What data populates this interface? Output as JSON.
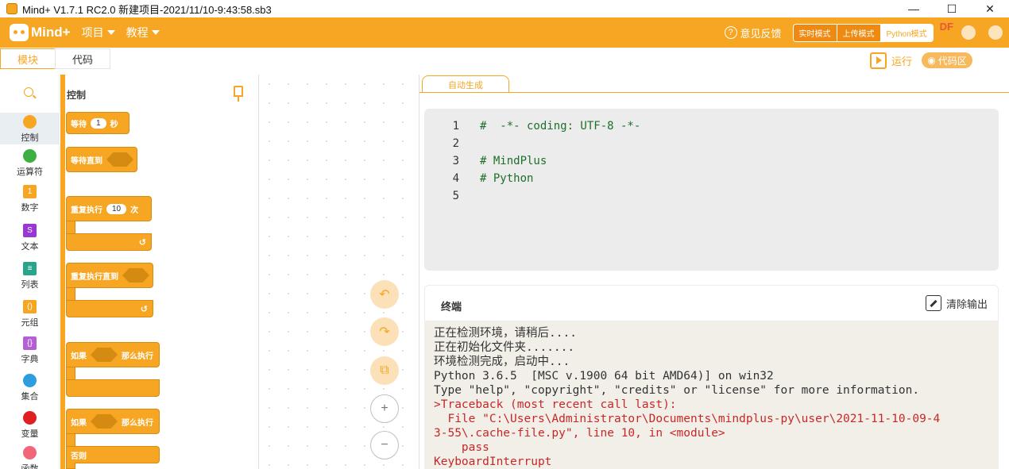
{
  "window": {
    "title": "Mind+ V1.7.1 RC2.0   新建项目-2021/11/10-9:43:58.sb3",
    "controls": [
      "—",
      "☐",
      "✕"
    ]
  },
  "header": {
    "logo": "Mind+",
    "menu": [
      {
        "label": "项目"
      },
      {
        "label": "教程"
      }
    ],
    "feedback": "意见反馈",
    "modes": [
      "实时模式",
      "上传模式",
      "Python模式"
    ],
    "active_mode": "Python模式",
    "watermark": "DF",
    "accent_color": "#f6a623"
  },
  "tabs": {
    "blocks": "模块",
    "code": "代码",
    "run": "运行",
    "code_zone": "代码区"
  },
  "categories": [
    {
      "label": "控制",
      "color": "#f6a623",
      "shape": "dot"
    },
    {
      "label": "运算符",
      "color": "#3cb043",
      "shape": "dot"
    },
    {
      "label": "数字",
      "color": "#f6a623",
      "shape": "square",
      "glyph": "1"
    },
    {
      "label": "文本",
      "color": "#9a36d6",
      "shape": "square",
      "glyph": "S"
    },
    {
      "label": "列表",
      "color": "#2aa58c",
      "shape": "square",
      "glyph": "≡"
    },
    {
      "label": "元组",
      "color": "#f6a623",
      "shape": "square",
      "glyph": "()"
    },
    {
      "label": "字典",
      "color": "#b45fd6",
      "shape": "square",
      "glyph": "{}"
    },
    {
      "label": "集合",
      "color": "#2c9ee0",
      "shape": "dot"
    },
    {
      "label": "变量",
      "color": "#e02020",
      "shape": "dot"
    },
    {
      "label": "函数",
      "color": "#f2667a",
      "shape": "dot"
    }
  ],
  "palette": {
    "section": "控制",
    "blocks": {
      "wait_label": "等待",
      "wait_value": "1",
      "wait_unit": "秒",
      "wait_until": "等待直到",
      "repeat_label": "重复执行",
      "repeat_value": "10",
      "repeat_unit": "次",
      "repeat_until": "重复执行直到",
      "if_label": "如果",
      "then_label": "那么执行",
      "if2_label": "如果",
      "then2_label": "那么执行",
      "else_label": "否则",
      "loop_arrow": "↺"
    }
  },
  "workspace": {
    "undo": "↶",
    "redo": "↷",
    "crop": "⧉",
    "zoom_in": "+",
    "zoom_out": "−"
  },
  "code_panel": {
    "tab": "自动生成",
    "lines": [
      {
        "n": "1",
        "text": "#  -*- coding: UTF-8 -*-"
      },
      {
        "n": "2",
        "text": ""
      },
      {
        "n": "3",
        "text": "# MindPlus"
      },
      {
        "n": "4",
        "text": "# Python"
      },
      {
        "n": "5",
        "text": ""
      }
    ]
  },
  "terminal": {
    "title": "终端",
    "clear": "清除输出",
    "lines": [
      {
        "text": "正在检测环境，请稍后....",
        "kind": "normal"
      },
      {
        "text": "正在初始化文件夹.......",
        "kind": "normal"
      },
      {
        "text": "环境检测完成，启动中...",
        "kind": "normal"
      },
      {
        "text": "Python 3.6.5  [MSC v.1900 64 bit AMD64)] on win32",
        "kind": "normal"
      },
      {
        "text": "Type \"help\", \"copyright\", \"credits\" or \"license\" for more information.",
        "kind": "normal"
      },
      {
        "text": ">Traceback (most recent call last):",
        "kind": "err"
      },
      {
        "text": "  File \"C:\\Users\\Administrator\\Documents\\mindplus-py\\user\\2021-11-10-09-4",
        "kind": "err"
      },
      {
        "text": "3-55\\.cache-file.py\", line 10, in <module>",
        "kind": "err"
      },
      {
        "text": "    pass",
        "kind": "err"
      },
      {
        "text": "KeyboardInterrupt",
        "kind": "err"
      }
    ]
  }
}
